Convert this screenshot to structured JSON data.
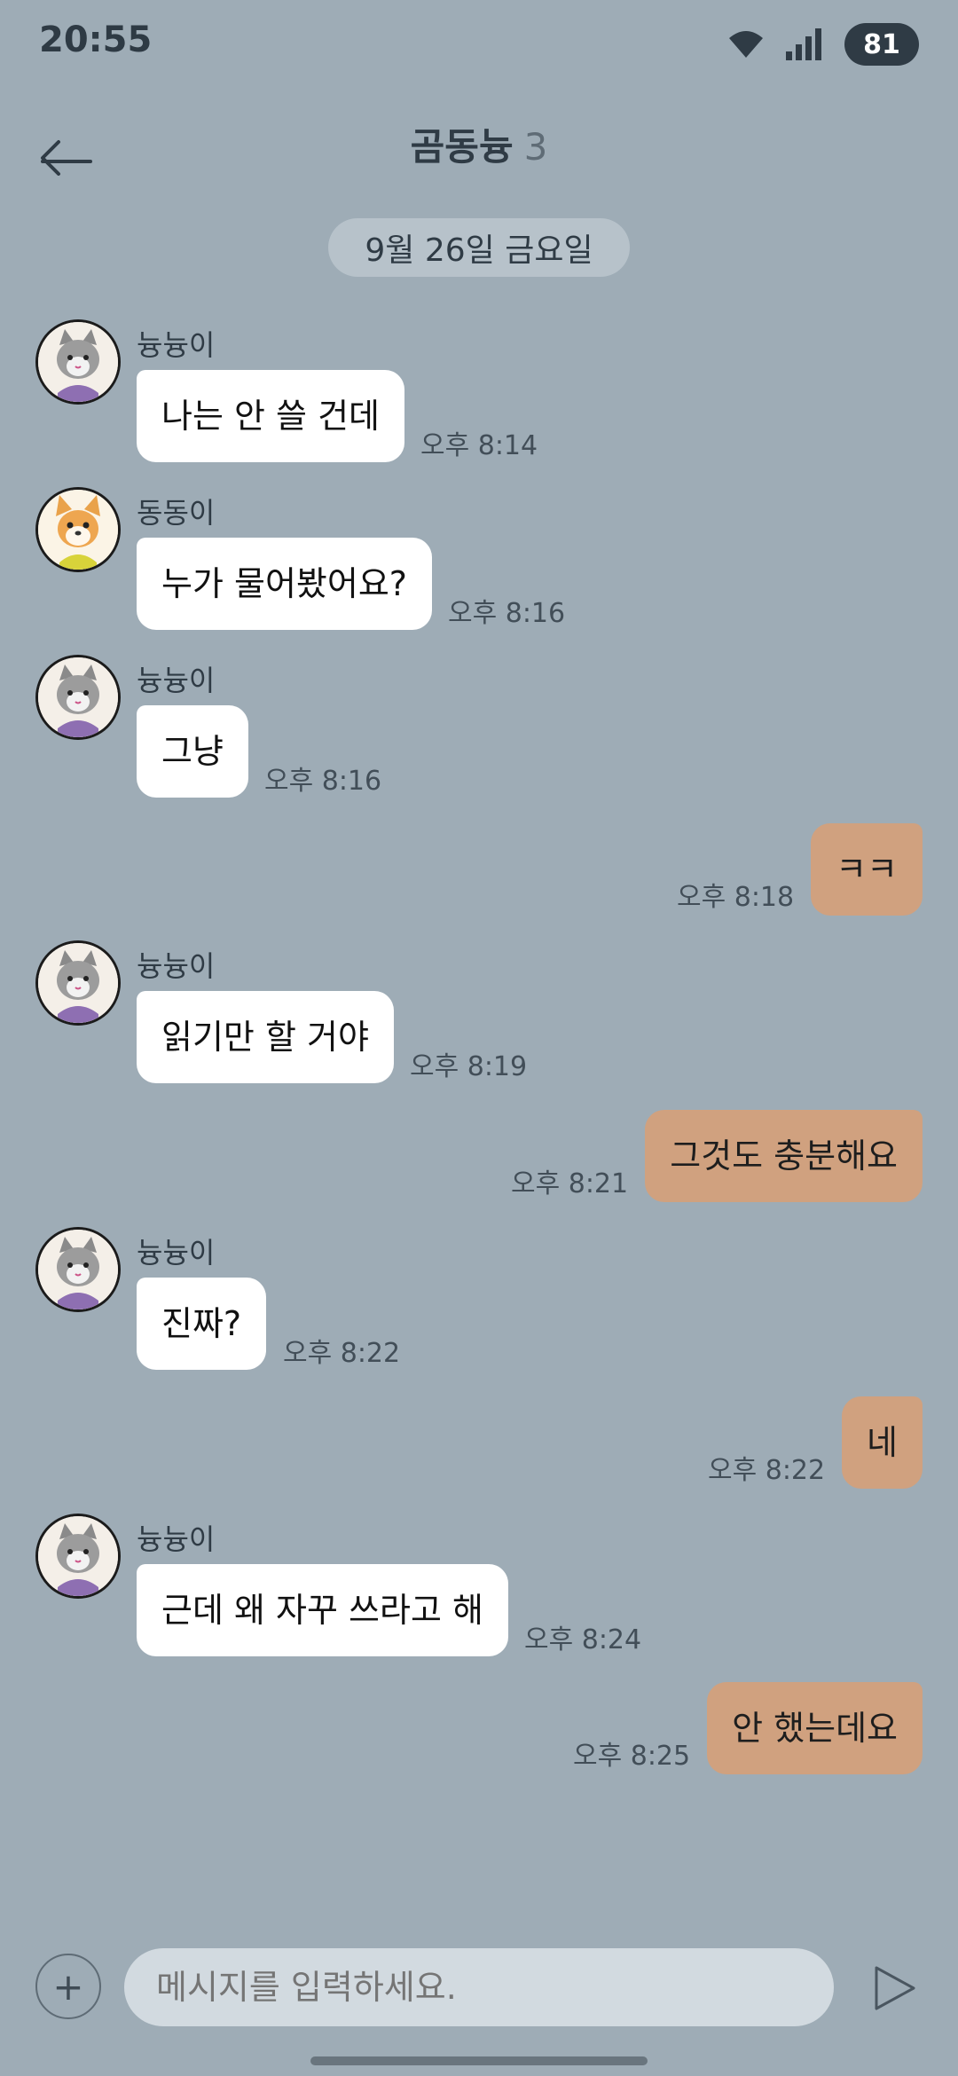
{
  "status_bar": {
    "time": "20:55",
    "battery": "81",
    "icons": [
      "wifi-icon",
      "cellular-signal-icon",
      "battery-icon"
    ]
  },
  "header": {
    "title": "곰동늉",
    "member_count": "3",
    "back_icon": "arrow-left-icon"
  },
  "date_divider": "9월 26일 금요일",
  "messages": [
    {
      "direction": "in",
      "sender": "늉늉이",
      "avatar": "cat",
      "text": "나는 안 쓸 건데",
      "time": "오후 8:14"
    },
    {
      "direction": "in",
      "sender": "동동이",
      "avatar": "dog",
      "text": "누가 물어봤어요?",
      "time": "오후 8:16"
    },
    {
      "direction": "in",
      "sender": "늉늉이",
      "avatar": "cat",
      "text": "그냥",
      "time": "오후 8:16"
    },
    {
      "direction": "out",
      "text": "ㅋㅋ",
      "time": "오후 8:18"
    },
    {
      "direction": "in",
      "sender": "늉늉이",
      "avatar": "cat",
      "text": "읽기만 할 거야",
      "time": "오후 8:19"
    },
    {
      "direction": "out",
      "text": "그것도 충분해요",
      "time": "오후 8:21"
    },
    {
      "direction": "in",
      "sender": "늉늉이",
      "avatar": "cat",
      "text": "진짜?",
      "time": "오후 8:22"
    },
    {
      "direction": "out",
      "text": "네",
      "time": "오후 8:22"
    },
    {
      "direction": "in",
      "sender": "늉늉이",
      "avatar": "cat",
      "text": "근데 왜 자꾸 쓰라고 해",
      "time": "오후 8:24"
    },
    {
      "direction": "out",
      "text": "안 했는데요",
      "time": "오후 8:25"
    }
  ],
  "composer": {
    "placeholder": "메시지를 입력하세요.",
    "plus_icon": "plus-icon",
    "send_icon": "send-icon"
  },
  "colors": {
    "background": "#9eacb6",
    "incoming_bubble": "#ffffff",
    "outgoing_bubble": "#d0a17f",
    "date_pill": "#b7c2ca"
  }
}
